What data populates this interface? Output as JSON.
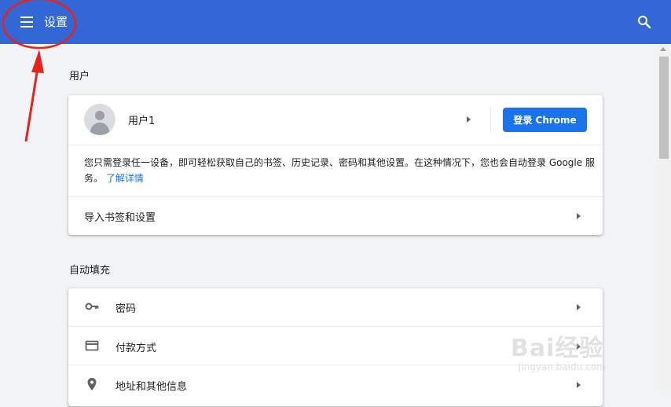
{
  "header": {
    "title": "设置",
    "menu_icon": "hamburger-menu-icon",
    "search_icon": "search-icon",
    "color": "#3367d6"
  },
  "people_section": {
    "title": "用户",
    "user_name": "用户1",
    "signin_label": "登录 Chrome",
    "description": "您只需登录任一设备，即可轻松获取自己的书签、历史记录、密码和其他设置。在这种情况下，您也会自动登录 Google 服务。",
    "learn_more": "了解详情",
    "import_label": "导入书签和设置"
  },
  "autofill_section": {
    "title": "自动填充",
    "items": [
      {
        "label": "密码",
        "icon": "key-icon"
      },
      {
        "label": "付款方式",
        "icon": "credit-card-icon"
      },
      {
        "label": "地址和其他信息",
        "icon": "location-pin-icon"
      }
    ]
  },
  "watermark": {
    "main": "Bai经验",
    "sub": "jingyan.baidu.com"
  },
  "colors": {
    "accent": "#1a73e8",
    "annotation": "#e8221b"
  }
}
